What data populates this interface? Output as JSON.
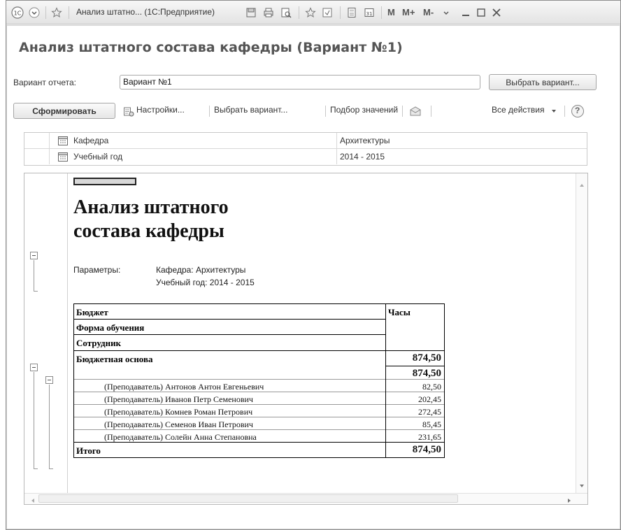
{
  "window": {
    "title": "Анализ штатно... (1С:Предприятие)",
    "m_buttons": [
      "M",
      "M+",
      "M-"
    ]
  },
  "form": {
    "title": "Анализ штатного состава кафедры (Вариант №1)"
  },
  "variant": {
    "label": "Вариант отчета:",
    "value": "Вариант №1",
    "choose_button": "Выбрать вариант..."
  },
  "toolbar": {
    "generate": "Сформировать",
    "settings": "Настройки...",
    "choose_variant": "Выбрать вариант...",
    "select_values": "Подбор значений",
    "all_actions": "Все действия",
    "help": "?"
  },
  "parameters": [
    {
      "name": "Кафедра",
      "value": "Архитектуры"
    },
    {
      "name": "Учебный год",
      "value": "2014 - 2015"
    }
  ],
  "report": {
    "title_line1": "Анализ штатного",
    "title_line2": "состава кафедры",
    "params_label": "Параметры:",
    "param_line1": "Кафедра: Архитектуры",
    "param_line2": "Учебный год: 2014 - 2015",
    "headers": {
      "budget": "Бюджет",
      "form": "Форма обучения",
      "employee": "Сотрудник",
      "hours": "Часы"
    },
    "group": {
      "name": "Бюджетная основа",
      "value": "874,50"
    },
    "subgroup": {
      "name": "",
      "value": "874,50"
    },
    "rows": [
      {
        "name": "(Преподаватель) Антонов Антон Евгеньевич",
        "value": "82,50"
      },
      {
        "name": "(Преподаватель) Иванов Петр Семенович",
        "value": "202,45"
      },
      {
        "name": "(Преподаватель) Комнев Роман Петрович",
        "value": "272,45"
      },
      {
        "name": "(Преподаватель) Семенов Иван Петрович",
        "value": "85,45"
      },
      {
        "name": "(Преподаватель) Солейн Анна Степановна",
        "value": "231,65"
      }
    ],
    "total": {
      "name": "Итого",
      "value": "874,50"
    }
  }
}
